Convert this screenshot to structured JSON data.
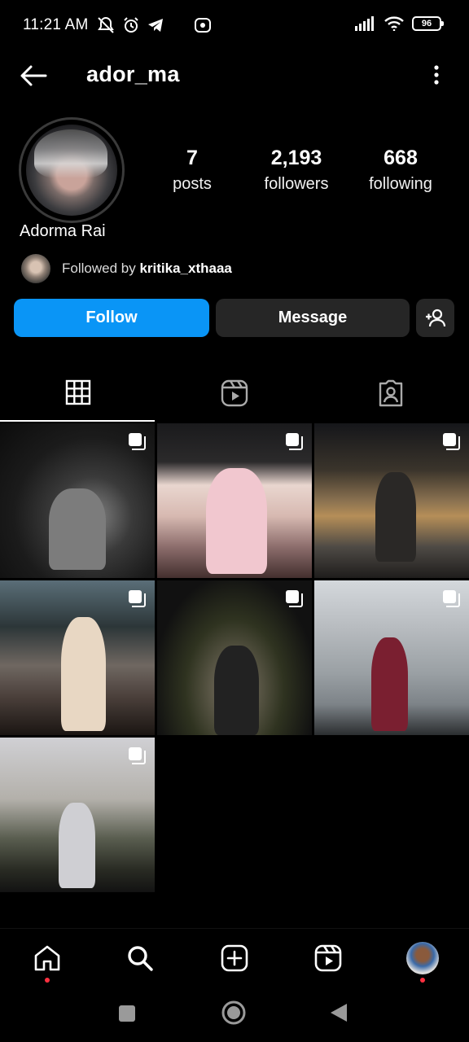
{
  "status_bar": {
    "time": "11:21 AM",
    "battery": "96",
    "icons": [
      "mute-icon",
      "alarm-icon",
      "telegram-icon",
      "record-icon",
      "signal-icon",
      "wifi-icon",
      "battery-icon"
    ]
  },
  "header": {
    "username": "ador_ma"
  },
  "profile": {
    "display_name": "Adorma Rai",
    "stats": [
      {
        "value": "7",
        "label": "posts"
      },
      {
        "value": "2,193",
        "label": "followers"
      },
      {
        "value": "668",
        "label": "following"
      }
    ],
    "followed_by_prefix": "Followed by",
    "followed_by_user": "kritika_xthaaa"
  },
  "actions": {
    "follow_label": "Follow",
    "message_label": "Message"
  },
  "tabs": [
    "grid-icon",
    "reels-icon",
    "tagged-icon"
  ],
  "grid": {
    "post_count": 7
  },
  "bottom_nav": [
    "home-icon",
    "search-icon",
    "create-icon",
    "reels-icon",
    "profile-avatar"
  ],
  "colors": {
    "accent": "#0a95f6",
    "button_dark": "#262626",
    "notification": "#ff3040"
  }
}
